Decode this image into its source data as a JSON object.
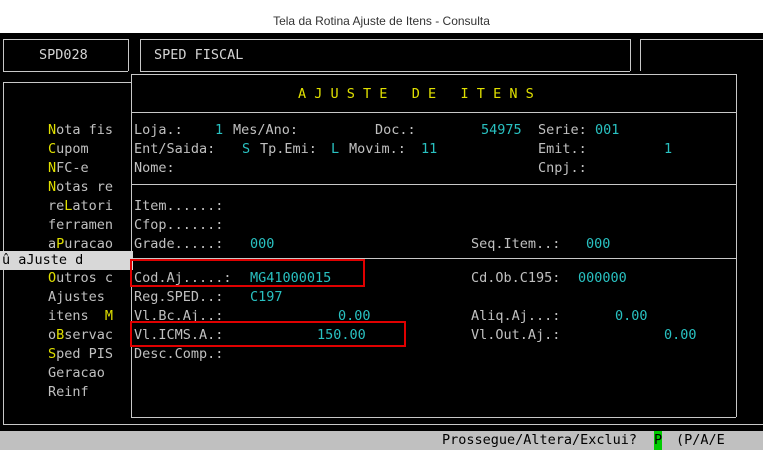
{
  "caption": "Tela da Rotina Ajuste de Itens - Consulta",
  "header": {
    "program_code": "SPD028",
    "system_title": "SPED FISCAL",
    "screen_title": "A J U S T E   D E   I T E N S"
  },
  "menu": {
    "items": [
      {
        "hotkey": "N",
        "rest": "ota fis"
      },
      {
        "hotkey": "C",
        "rest": "upom"
      },
      {
        "hotkey": "N",
        "rest": "FC-e"
      },
      {
        "hotkey": "N",
        "rest": "otas re"
      },
      {
        "prefix": "re",
        "hotkey": "L",
        "rest": "atori"
      },
      {
        "prefix": "ferramen",
        "hotkey": "",
        "rest": ""
      },
      {
        "prefix": "a",
        "hotkey": "P",
        "rest": "uracao"
      },
      {
        "prefix": "û aJuste d",
        "hotkey": "",
        "rest": "",
        "selected": true
      },
      {
        "hotkey": "O",
        "rest": "utros c"
      },
      {
        "prefix": "Ajustes",
        "hotkey": "",
        "rest": ""
      },
      {
        "prefix": "itens  ",
        "hotkey": "M",
        "rest": ""
      },
      {
        "prefix": "o",
        "hotkey": "B",
        "rest": "servac"
      },
      {
        "hotkey": "S",
        "rest": "ped PIS"
      },
      {
        "prefix": "Geracao",
        "hotkey": "",
        "rest": ""
      },
      {
        "prefix": "Reinf",
        "hotkey": "",
        "rest": ""
      }
    ]
  },
  "doc": {
    "loja_label": "Loja.:",
    "loja_value": "1",
    "mes_ano_label": "Mes/Ano:",
    "doc_label": "Doc.:",
    "doc_value": "54975",
    "serie_label": "Serie:",
    "serie_value": "001",
    "ent_saida_label": "Ent/Saida:",
    "ent_saida_value": "S",
    "tp_emi_label": "Tp.Emi:",
    "tp_emi_value": "L",
    "movim_label": "Movim.:",
    "movim_value": "11",
    "emit_label": "Emit.:",
    "emit_value": "1",
    "nome_label": "Nome:",
    "cnpj_label": "Cnpj.:"
  },
  "item": {
    "item_label": "Item......:",
    "cfop_label": "Cfop......:",
    "grade_label": "Grade.....:",
    "grade_value": "000",
    "seq_item_label": "Seq.Item..:",
    "seq_item_value": "000"
  },
  "ajuste": {
    "cod_aj_label": "Cod.Aj.....:",
    "cod_aj_value": "MG41000015",
    "cd_ob_label": "Cd.Ob.C195:",
    "cd_ob_value": "000000",
    "reg_sped_label": "Reg.SPED..:",
    "reg_sped_value": "C197",
    "vl_bc_label": "Vl.Bc.Aj..:",
    "vl_bc_value": "0.00",
    "aliq_label": "Aliq.Aj...:",
    "aliq_value": "0.00",
    "vl_icms_label": "Vl.ICMS.A.:",
    "vl_icms_value": "150.00",
    "vl_out_label": "Vl.Out.Aj.:",
    "vl_out_value": "0.00",
    "desc_comp_label": "Desc.Comp.:"
  },
  "status": {
    "prompt": "Prossegue/Altera/Exclui?",
    "answer": "P",
    "options": "(P/A/E"
  }
}
